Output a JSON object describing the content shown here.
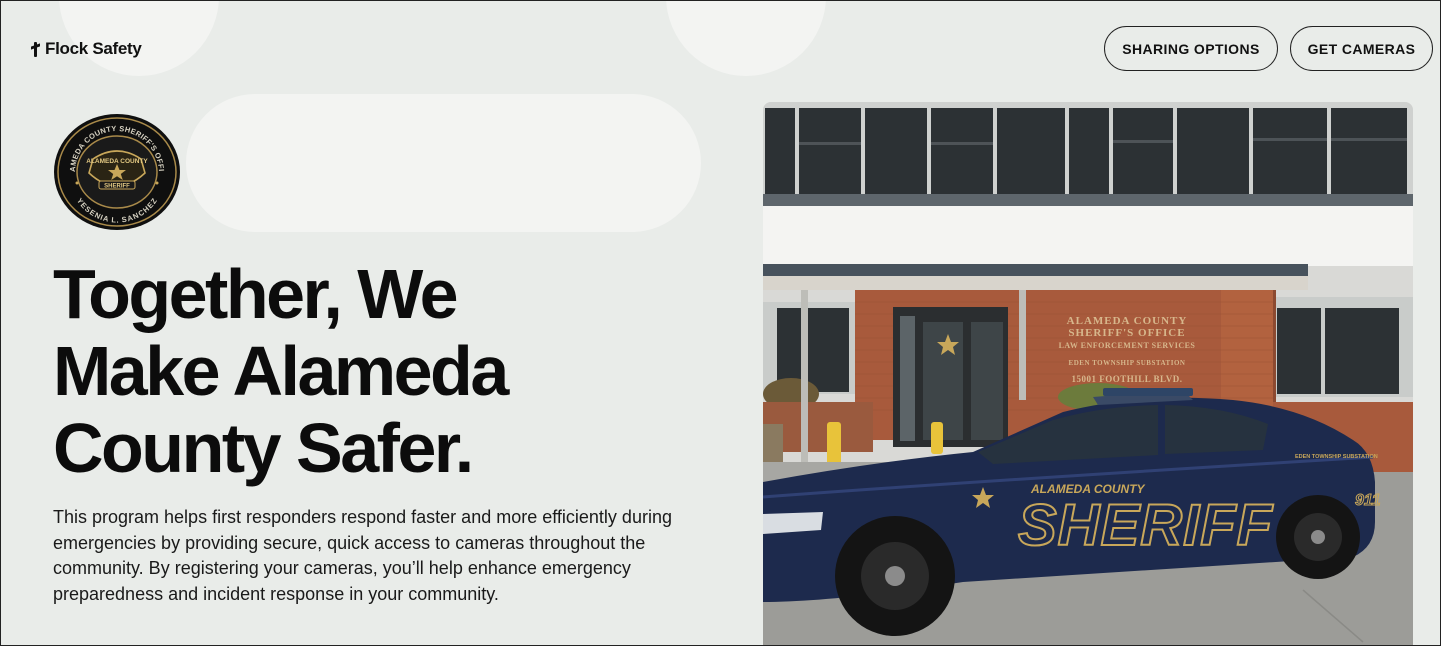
{
  "header": {
    "logo_text": "Flock Safety",
    "logo_icon": "flock-mark-icon",
    "buttons": {
      "sharing_options": "SHARING OPTIONS",
      "get_cameras": "GET CAMERAS"
    }
  },
  "badge": {
    "icon": "sheriff-seal-icon",
    "top_text": "ALAMEDA COUNTY SHERIFF'S OFFICE",
    "shield_text": "ALAMEDA COUNTY",
    "ribbon_text": "SHERIFF",
    "bottom_text": "YESENIA L. SANCHEZ"
  },
  "hero": {
    "title_lines": [
      "Together, We",
      "Make Alameda",
      "County Safer."
    ],
    "body": "This program helps first responders respond faster and more efficiently during emergencies by providing secure, quick access to cameras throughout the community. By registering your cameras, you’ll help enhance emergency preparedness and incident response in your community."
  },
  "photo": {
    "building_sign": [
      "ALAMEDA COUNTY",
      "SHERIFF'S OFFICE",
      "LAW ENFORCEMENT SERVICES",
      "EDEN TOWNSHIP SUBSTATION",
      "15001 FOOTHILL BLVD."
    ],
    "car_text_top": "ALAMEDA COUNTY",
    "car_text_main": "SHERIFF",
    "car_text_rear": "EDEN TOWNSHIP SUBSTATION",
    "car_number": "911",
    "colors": {
      "car_body": "#1d2a4d",
      "car_lettering": "#c8a75a",
      "brick": "#a85a3c"
    }
  }
}
